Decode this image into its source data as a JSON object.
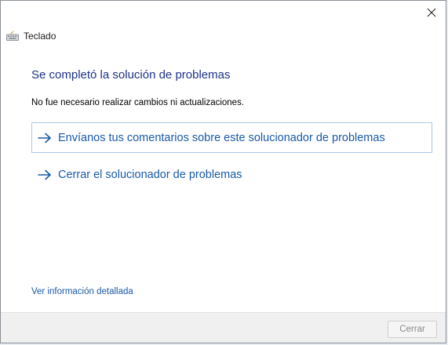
{
  "window": {
    "close_icon": "close-icon"
  },
  "header": {
    "app_icon": "keyboard-icon",
    "app_title": "Teclado"
  },
  "main": {
    "heading": "Se completó la solución de problemas",
    "message": "No fue necesario realizar cambios ni actualizaciones.",
    "options": [
      {
        "label": "Envíanos tus comentarios sobre este solucionador de problemas",
        "icon": "arrow-right-icon",
        "focused": true
      },
      {
        "label": "Cerrar el solucionador de problemas",
        "icon": "arrow-right-icon",
        "focused": false
      }
    ],
    "details_link": "Ver información detallada"
  },
  "footer": {
    "cancel_label": "Cerrar",
    "cancel_enabled": false
  },
  "colors": {
    "heading": "#1e3287",
    "link": "#1a5aa6",
    "focus_border": "#a9c7e6",
    "footer_bg": "#f0f0f0"
  }
}
